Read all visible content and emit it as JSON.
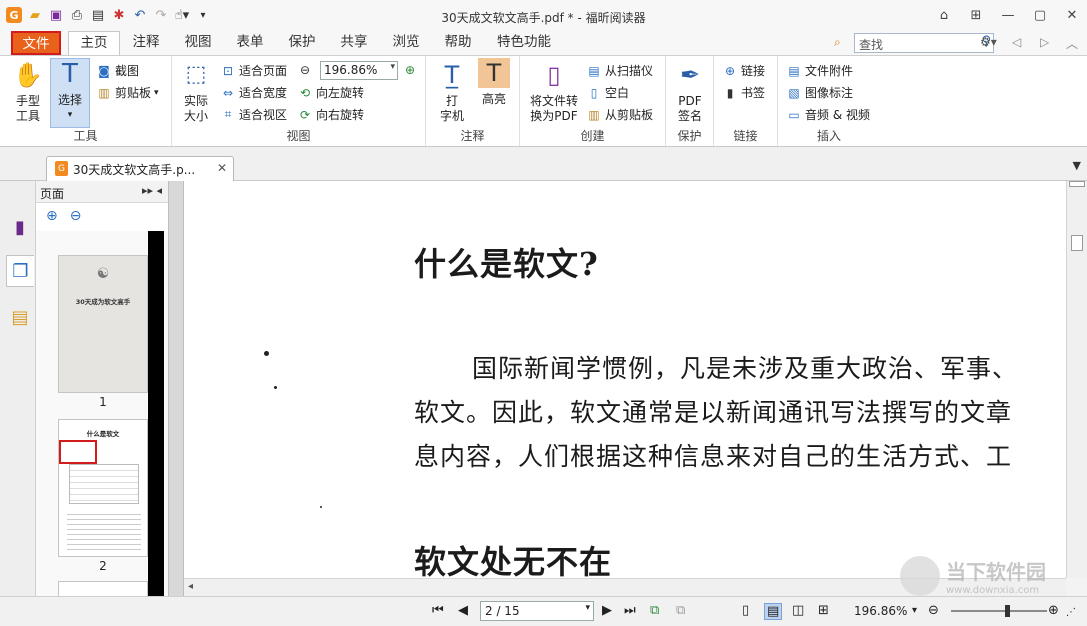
{
  "window": {
    "title": "30天成文软文高手.pdf * - 福昕阅读器"
  },
  "menu": {
    "file": "文件",
    "tabs": [
      "主页",
      "注释",
      "视图",
      "表单",
      "保护",
      "共享",
      "浏览",
      "帮助",
      "特色功能"
    ],
    "search_placeholder": "查找"
  },
  "ribbon": {
    "tools": {
      "hand": "手型\n工具",
      "select": "选择",
      "screenshot": "截图",
      "clipboard": "剪贴板",
      "group": "工具"
    },
    "view": {
      "actual": "实际\n大小",
      "fit_page": "适合页面",
      "fit_width": "适合宽度",
      "fit_visible": "适合视区",
      "zoom": "196.86%",
      "rotate_left": "向左旋转",
      "rotate_right": "向右旋转",
      "group": "视图"
    },
    "comment": {
      "typewriter": "打\n字机",
      "highlight": "高亮",
      "group": "注释"
    },
    "create": {
      "convert": "将文件转\n换为PDF",
      "from_scanner": "从扫描仪",
      "blank": "空白",
      "from_clipboard": "从剪贴板",
      "group": "创建"
    },
    "protect": {
      "sign": "PDF\n签名",
      "group": "保护"
    },
    "links": {
      "link": "链接",
      "bookmark": "书签",
      "group": "链接"
    },
    "insert": {
      "attachment": "文件附件",
      "image_annot": "图像标注",
      "media": "音频 & 视频",
      "group": "插入"
    }
  },
  "doc_tab": {
    "label": "30天成文软文高手.p..."
  },
  "panel": {
    "title": "页面",
    "pages": [
      "1",
      "2"
    ]
  },
  "document": {
    "heading1": "什么是软文?",
    "lines": [
      "国际新闻学惯例，凡是未涉及重大政治、军事、",
      "软文。因此，软文通常是以新闻通讯写法撰写的文章",
      "息内容，人们根据这种信息来对自己的生活方式、工"
    ],
    "heading2": "软文处无不在"
  },
  "thumbs": {
    "cover_title": "30天成为软文高手",
    "p2_title": "什么是软文"
  },
  "status": {
    "page": "2 / 15",
    "zoom": "196.86%"
  },
  "watermark": {
    "t1": "当下软件园",
    "t2": "www.downxia.com"
  }
}
